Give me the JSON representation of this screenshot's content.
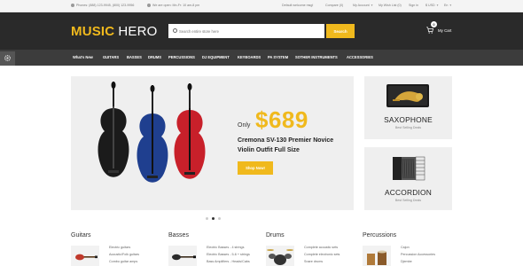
{
  "topbar": {
    "phones": "Phones: (888) 123-9945, (800) 123-9956",
    "hours": "We are open: Mn-Fr: 10 am-8 pm",
    "welcome": "Default welcome msg!",
    "compare": "Compare (0)",
    "account": "My Account",
    "wishlist": "My Wish List (0)",
    "signin": "Sign in",
    "currency": "$ USD",
    "language": "En"
  },
  "header": {
    "logo_part1": "MUSIC",
    "logo_part2": "HERO",
    "search_placeholder": "Search entire store here",
    "search_button": "Search",
    "cart_count": "0",
    "cart_label": "My Cart"
  },
  "nav": {
    "items": [
      "What's New",
      "GUITARS",
      "BASSES",
      "DRUMS",
      "PERCUSSIONS",
      "DJ EQUIPMENT",
      "KEYBOARDS",
      "PA SYSTEM",
      "SOTHER INSTRUMENTS",
      "ACCESSORIES"
    ]
  },
  "hero": {
    "only_label": "Only",
    "price": "$689",
    "title": "Cremona SV-130 Premier Novice Violin Outfit Full Size",
    "shop_button": "Shop Now!",
    "slide_count": 3,
    "active_slide": 2
  },
  "panels": [
    {
      "title": "SAXOPHONE",
      "subtitle": "Best Selling Deals"
    },
    {
      "title": "ACCORDION",
      "subtitle": "Best Selling Deals"
    }
  ],
  "categories": [
    {
      "title": "Guitars",
      "links": [
        "Electric guitars",
        "Acoustic/Folk guitars",
        "Combo guitar amps"
      ]
    },
    {
      "title": "Basses",
      "links": [
        "Electric Basses - 4 strings",
        "Electric Basses - 5-6 + strings",
        "Bass Amplifiers - Heads/Cabs"
      ]
    },
    {
      "title": "Drums",
      "links": [
        "Complete acoustic sets",
        "Complete electronic sets",
        "Snare drums"
      ]
    },
    {
      "title": "Percussions",
      "links": [
        "Cajon",
        "Percussion Accessories",
        "Djembe"
      ]
    }
  ],
  "colors": {
    "accent": "#f0b91d",
    "header_bg": "#2a2a2a",
    "nav_bg": "#3c3c3c",
    "violin_colors": [
      "#1b1b1b",
      "#1f3f8f",
      "#c8202a"
    ]
  }
}
